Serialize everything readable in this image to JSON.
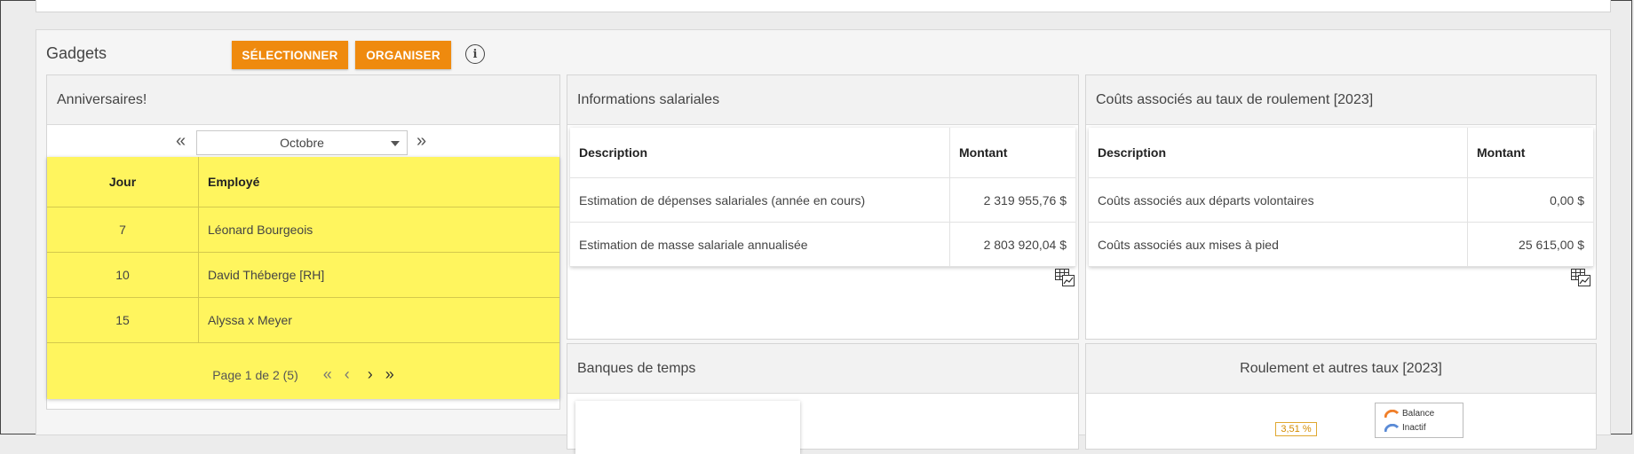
{
  "gadgets": {
    "title": "Gadgets",
    "select_label": "SÉLECTIONNER",
    "organize_label": "ORGANISER",
    "info_glyph": "i"
  },
  "birthdays": {
    "title": "Anniversaires!",
    "month": "Octobre",
    "headers": {
      "day": "Jour",
      "employee": "Employé"
    },
    "rows": [
      {
        "day": "7",
        "employee": "Léonard Bourgeois"
      },
      {
        "day": "10",
        "employee": "David Théberge [RH]"
      },
      {
        "day": "15",
        "employee": "Alyssa x Meyer"
      }
    ],
    "pager_text": "Page 1 de 2 (5)",
    "highlight_color": "#fff55e"
  },
  "salary": {
    "title": "Informations salariales",
    "headers": {
      "description": "Description",
      "amount": "Montant"
    },
    "rows": [
      {
        "description": "Estimation de dépenses salariales (année en cours)",
        "amount": "2 319 955,76 $"
      },
      {
        "description": "Estimation de masse salariale annualisée",
        "amount": "2 803 920,04 $"
      }
    ]
  },
  "turnover_costs": {
    "title": "Coûts associés au taux de roulement [2023]",
    "headers": {
      "description": "Description",
      "amount": "Montant"
    },
    "rows": [
      {
        "description": "Coûts associés aux départs volontaires",
        "amount": "0,00 $"
      },
      {
        "description": "Coûts associés aux mises à pied",
        "amount": "25 615,00 $"
      }
    ]
  },
  "time_banks": {
    "title": "Banques de temps"
  },
  "turnover_rates": {
    "title": "Roulement et autres taux [2023]",
    "badge": "3,51 %",
    "legend": [
      {
        "label": "Balance",
        "color": "#f07f2a"
      },
      {
        "label": "Inactif",
        "color": "#5b8bd6"
      }
    ]
  },
  "colors": {
    "accent": "#ef8a0e"
  }
}
